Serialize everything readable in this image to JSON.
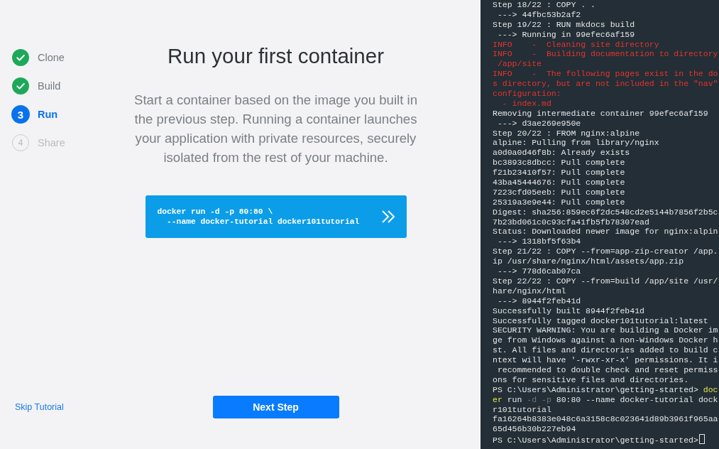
{
  "steps": [
    {
      "label": "Clone",
      "completed": true,
      "selected": false
    },
    {
      "label": "Build",
      "completed": true,
      "selected": false
    },
    {
      "label": "Run",
      "number": "3",
      "completed": false,
      "selected": true
    },
    {
      "label": "Share",
      "number": "4",
      "completed": false,
      "selected": false
    }
  ],
  "skip_link": "Skip Tutorial",
  "main": {
    "title": "Run your first container",
    "description": "Start a container based on the image you built in the previous step. Running a container launches your application with private resources, securely isolated from the rest of your machine.",
    "command_lines": [
      "docker run -d -p 80:80 \\",
      "  --name docker-tutorial docker101tutorial"
    ]
  },
  "next_button": "Next Step",
  "terminal": {
    "cursor": true,
    "lines": [
      {
        "kind": "output",
        "text": "Step 18/22 : COPY . ."
      },
      {
        "kind": "output",
        "text": " ---> 44fbc53b2af2"
      },
      {
        "kind": "output",
        "text": "Step 19/22 : RUN mkdocs build"
      },
      {
        "kind": "output",
        "text": " ---> Running in 99efec6af159"
      },
      {
        "kind": "error",
        "text": "INFO    -  Cleaning site directory"
      },
      {
        "kind": "error",
        "text": "INFO    -  Building documentation to directory"
      },
      {
        "kind": "error",
        "text": " /app/site"
      },
      {
        "kind": "error",
        "text": "INFO    -  The following pages exist in the do"
      },
      {
        "kind": "error",
        "text": "s directory, but are not included in the \"nav\""
      },
      {
        "kind": "error",
        "text": "configuration:"
      },
      {
        "kind": "error",
        "text": "  - index.md"
      },
      {
        "kind": "output",
        "text": "Removing intermediate container 99efec6af159"
      },
      {
        "kind": "output",
        "text": " ---> d3ae269e950e"
      },
      {
        "kind": "output",
        "text": "Step 20/22 : FROM nginx:alpine"
      },
      {
        "kind": "output",
        "text": "alpine: Pulling from library/nginx"
      },
      {
        "kind": "output",
        "text": "a0d0a0d46f8b: Already exists"
      },
      {
        "kind": "output",
        "text": "bc3893c8dbcc: Pull complete"
      },
      {
        "kind": "output",
        "text": "f21b23410f57: Pull complete"
      },
      {
        "kind": "output",
        "text": "43ba45444676: Pull complete"
      },
      {
        "kind": "output",
        "text": "7223cfd05eeb: Pull complete"
      },
      {
        "kind": "output",
        "text": "25319a3e9e44: Pull complete"
      },
      {
        "kind": "output",
        "text": "Digest: sha256:859ec6f2dc548cd2e5144b7856f2b5c"
      },
      {
        "kind": "output",
        "text": "7b23bd061c0c93cfa41fb5fb78307ead"
      },
      {
        "kind": "output",
        "text": "Status: Downloaded newer image for nginx:alpin"
      },
      {
        "kind": "output",
        "text": " ---> 1318bf5f63b4"
      },
      {
        "kind": "output",
        "text": "Step 21/22 : COPY --from=app-zip-creator /app."
      },
      {
        "kind": "output",
        "text": "ip /usr/share/nginx/html/assets/app.zip"
      },
      {
        "kind": "output",
        "text": " ---> 778d6cab07ca"
      },
      {
        "kind": "output",
        "text": "Step 22/22 : COPY --from=build /app/site /usr/"
      },
      {
        "kind": "output",
        "text": "hare/nginx/html"
      },
      {
        "kind": "output",
        "text": " ---> 8944f2feb41d"
      },
      {
        "kind": "output",
        "text": "Successfully built 8944f2feb41d"
      },
      {
        "kind": "output",
        "text": "Successfully tagged docker101tutorial:latest"
      },
      {
        "kind": "output",
        "text": "SECURITY WARNING: You are building a Docker im"
      },
      {
        "kind": "output",
        "text": "ge from Windows against a non-Windows Docker h"
      },
      {
        "kind": "output",
        "text": "st. All files and directories added to build c"
      },
      {
        "kind": "output",
        "text": "ntext will have '-rwxr-xr-x' permissions. It i"
      },
      {
        "kind": "output",
        "text": " recommended to double check and reset permiss"
      },
      {
        "kind": "output",
        "text": "ons for sensitive files and directories."
      },
      {
        "kind": "mixed",
        "segments": [
          {
            "kind": "output",
            "text": "PS C:\\Users\\Administrator\\getting-started> "
          },
          {
            "kind": "command",
            "text": "doc"
          }
        ]
      },
      {
        "kind": "mixed",
        "segments": [
          {
            "kind": "command",
            "text": "er"
          },
          {
            "kind": "output",
            "text": " run "
          },
          {
            "kind": "parameter",
            "text": "-d -p"
          },
          {
            "kind": "output",
            "text": " 80:80 --name docker-tutorial dock"
          }
        ]
      },
      {
        "kind": "output",
        "text": "r101tutorial"
      },
      {
        "kind": "output",
        "text": "fa16264b8383e048c6a3158c8c023641d89b3961f965aa"
      },
      {
        "kind": "output",
        "text": "65d456b30b227eb94"
      },
      {
        "kind": "output",
        "text": "PS C:\\Users\\Administrator\\getting-started>"
      }
    ]
  }
}
